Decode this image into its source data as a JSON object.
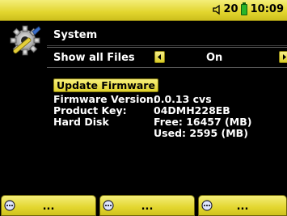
{
  "status": {
    "volume": "20",
    "time": "10:09"
  },
  "screen": {
    "title": "System"
  },
  "setting": {
    "label": "Show all Files",
    "value": "On"
  },
  "update_button": "Update Firmware",
  "info": {
    "firmware_label": "Firmware Version:",
    "firmware_value": "0.0.13 cvs",
    "product_label": "Product Key:",
    "product_value": "04DMH228EB",
    "disk_label": "Hard Disk",
    "disk_free": "Free: 16457 (MB)",
    "disk_used": "Used:  2595 (MB)"
  },
  "softkeys": [
    {
      "label": "...",
      "icon": "ellipsis-circle-icon"
    },
    {
      "label": "...",
      "icon": "ellipsis-circle-icon"
    },
    {
      "label": "...",
      "icon": "ellipsis-circle-icon"
    }
  ],
  "colors": {
    "accent": "#e2d52e",
    "background": "#000000",
    "battery": "#2ab52a"
  }
}
